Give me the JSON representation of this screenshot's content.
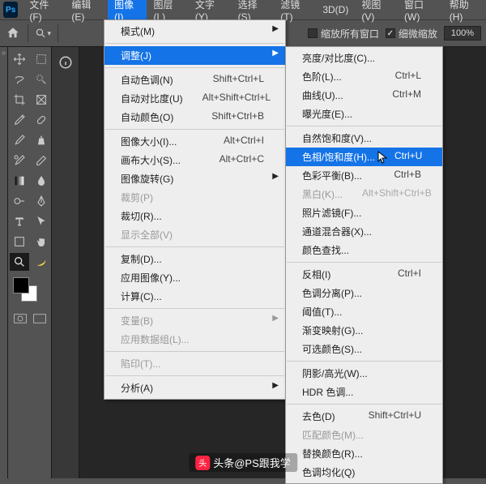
{
  "menubar": {
    "items": [
      {
        "label": "文件(F)"
      },
      {
        "label": "编辑(E)"
      },
      {
        "label": "图像(I)"
      },
      {
        "label": "图层(L)"
      },
      {
        "label": "文字(Y)"
      },
      {
        "label": "选择(S)"
      },
      {
        "label": "滤镜(T)"
      },
      {
        "label": "3D(D)"
      },
      {
        "label": "视图(V)"
      },
      {
        "label": "窗口(W)"
      },
      {
        "label": "帮助(H)"
      }
    ]
  },
  "optbar": {
    "zoom_all": "缩放所有窗口",
    "scrubby": "细微缩放",
    "zoom_value": "100%"
  },
  "dd1": {
    "mode": {
      "label": "模式(M)"
    },
    "adjust": {
      "label": "调整(J)"
    },
    "auto_tone": {
      "label": "自动色调(N)",
      "short": "Shift+Ctrl+L"
    },
    "auto_contrast": {
      "label": "自动对比度(U)",
      "short": "Alt+Shift+Ctrl+L"
    },
    "auto_color": {
      "label": "自动颜色(O)",
      "short": "Shift+Ctrl+B"
    },
    "img_size": {
      "label": "图像大小(I)...",
      "short": "Alt+Ctrl+I"
    },
    "canvas_size": {
      "label": "画布大小(S)...",
      "short": "Alt+Ctrl+C"
    },
    "rotate": {
      "label": "图像旋转(G)"
    },
    "crop": {
      "label": "裁剪(P)"
    },
    "trim": {
      "label": "裁切(R)..."
    },
    "reveal": {
      "label": "显示全部(V)"
    },
    "duplicate": {
      "label": "复制(D)..."
    },
    "apply_img": {
      "label": "应用图像(Y)..."
    },
    "calc": {
      "label": "计算(C)..."
    },
    "vars": {
      "label": "变量(B)"
    },
    "dataset": {
      "label": "应用数据组(L)..."
    },
    "trap": {
      "label": "陷印(T)..."
    },
    "analysis": {
      "label": "分析(A)"
    }
  },
  "dd2": {
    "brightness": {
      "label": "亮度/对比度(C)..."
    },
    "levels": {
      "label": "色阶(L)...",
      "short": "Ctrl+L"
    },
    "curves": {
      "label": "曲线(U)...",
      "short": "Ctrl+M"
    },
    "exposure": {
      "label": "曝光度(E)..."
    },
    "vibrance": {
      "label": "自然饱和度(V)..."
    },
    "hue": {
      "label": "色相/饱和度(H)...",
      "short": "Ctrl+U"
    },
    "balance": {
      "label": "色彩平衡(B)...",
      "short": "Ctrl+B"
    },
    "bw": {
      "label": "黑白(K)...",
      "short": "Alt+Shift+Ctrl+B"
    },
    "photo_filter": {
      "label": "照片滤镜(F)..."
    },
    "mixer": {
      "label": "通道混合器(X)..."
    },
    "lookup": {
      "label": "颜色查找..."
    },
    "invert": {
      "label": "反相(I)",
      "short": "Ctrl+I"
    },
    "posterize": {
      "label": "色调分离(P)..."
    },
    "threshold": {
      "label": "阈值(T)..."
    },
    "gmap": {
      "label": "渐变映射(G)..."
    },
    "selective": {
      "label": "可选颜色(S)..."
    },
    "shadows": {
      "label": "阴影/高光(W)..."
    },
    "hdr": {
      "label": "HDR 色调..."
    },
    "desat": {
      "label": "去色(D)",
      "short": "Shift+Ctrl+U"
    },
    "match": {
      "label": "匹配颜色(M)..."
    },
    "replace": {
      "label": "替换颜色(R)..."
    },
    "equalize": {
      "label": "色调均化(Q)"
    }
  },
  "watermark": {
    "text": "头条@PS跟我学"
  }
}
